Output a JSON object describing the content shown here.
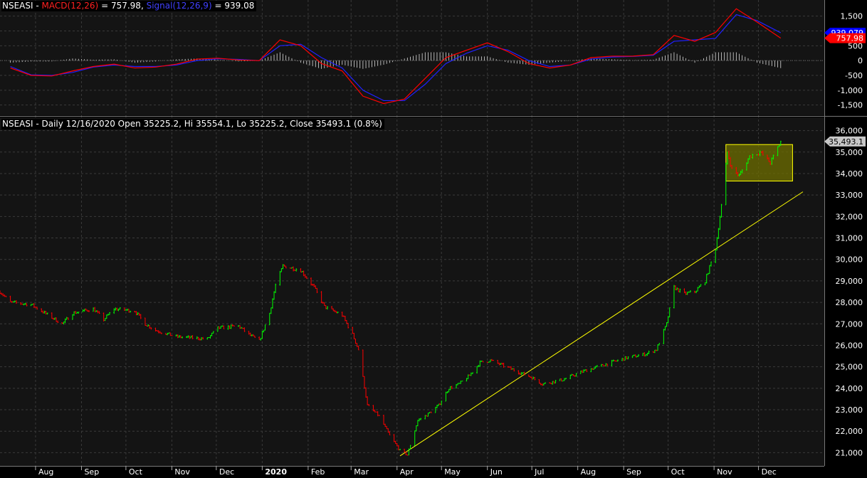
{
  "macd_panel": {
    "symbol": "NSEASI",
    "sep": "-",
    "macd_label": "MACD(12,26)",
    "macd_value": "757.98",
    "signal_label": "Signal(12,26,9)",
    "signal_value": "939.08",
    "colors": {
      "macd": "#ff0000",
      "signal": "#2020ff",
      "hist": "#ffffff"
    },
    "badges": [
      {
        "text": "939.079",
        "value": 939.08,
        "bg": "#0000ff",
        "fg": "#ffffff"
      },
      {
        "text": "757.98",
        "value": 757.98,
        "bg": "#ff0000",
        "fg": "#ffffff"
      }
    ]
  },
  "price_panel": {
    "title": "NSEASI - Daily 12/16/2020 Open 35225.2, Hi 35554.1, Lo 35225.2, Close 35493.1 (0.8%)",
    "last_badge": {
      "text": "35,493.1",
      "value": 35493.1,
      "bg": "#c8c8c8",
      "fg": "#000000"
    },
    "colors": {
      "up": "#00ff00",
      "down": "#ff0000",
      "trendline": "#ffff00",
      "box_fill": "#6e6e00",
      "box_stroke": "#ffff00"
    }
  },
  "chart_data": [
    {
      "type": "line",
      "title": "MACD(12,26) / Signal(12,26,9)",
      "y_ticks": [
        1500,
        1000,
        500,
        0,
        -500,
        -1000,
        -1500
      ],
      "y_tick_labels": [
        "1,500",
        "1,000",
        "500",
        "0",
        "-500",
        "-1,000",
        "-1,500"
      ],
      "ylim": [
        -1700,
        1900
      ],
      "x": [
        "2019-07-15",
        "2019-07-29",
        "2019-08-12",
        "2019-08-26",
        "2019-09-09",
        "2019-09-23",
        "2019-10-07",
        "2019-10-21",
        "2019-11-04",
        "2019-11-18",
        "2019-12-02",
        "2019-12-16",
        "2019-12-30",
        "2020-01-13",
        "2020-01-27",
        "2020-02-10",
        "2020-02-24",
        "2020-03-09",
        "2020-03-23",
        "2020-04-06",
        "2020-04-20",
        "2020-05-04",
        "2020-05-18",
        "2020-06-01",
        "2020-06-15",
        "2020-06-29",
        "2020-07-13",
        "2020-07-27",
        "2020-08-10",
        "2020-08-24",
        "2020-09-07",
        "2020-09-21",
        "2020-10-05",
        "2020-10-19",
        "2020-11-02",
        "2020-11-16",
        "2020-11-30",
        "2020-12-16"
      ],
      "series": [
        {
          "name": "MACD(12,26)",
          "values": [
            -250,
            -500,
            -520,
            -350,
            -200,
            -120,
            -250,
            -220,
            -120,
            50,
            80,
            20,
            0,
            700,
            500,
            -100,
            -350,
            -1200,
            -1450,
            -1300,
            -600,
            100,
            350,
            600,
            300,
            -100,
            -250,
            -150,
            100,
            150,
            150,
            200,
            850,
            650,
            950,
            1750,
            1300,
            757.98
          ]
        },
        {
          "name": "Signal(12,26,9)",
          "values": [
            -200,
            -480,
            -500,
            -400,
            -220,
            -150,
            -200,
            -200,
            -150,
            0,
            60,
            40,
            0,
            500,
            550,
            100,
            -250,
            -1000,
            -1350,
            -1350,
            -800,
            -100,
            250,
            500,
            350,
            0,
            -200,
            -150,
            50,
            120,
            140,
            180,
            650,
            700,
            750,
            1550,
            1350,
            939.08
          ]
        }
      ]
    },
    {
      "type": "candlestick",
      "title": "NSEASI - Daily",
      "y_ticks": [
        21000,
        22000,
        23000,
        24000,
        25000,
        26000,
        27000,
        28000,
        29000,
        30000,
        31000,
        32000,
        33000,
        34000,
        35000,
        36000
      ],
      "y_tick_labels": [
        "21,000",
        "22,000",
        "23,000",
        "24,000",
        "25,000",
        "26,000",
        "27,000",
        "28,000",
        "29,000",
        "30,000",
        "31,000",
        "32,000",
        "33,000",
        "34,000",
        "35,000",
        "36,000"
      ],
      "ylim": [
        20550,
        36450
      ],
      "x_tick_labels": [
        "Aug",
        "Sep",
        "Oct",
        "Nov",
        "Dec",
        "2020",
        "Feb",
        "Mar",
        "Apr",
        "May",
        "Jun",
        "Jul",
        "Aug",
        "Sep",
        "Oct",
        "Nov",
        "Dec"
      ],
      "x_tick_positions": [
        "2019-08-01",
        "2019-09-01",
        "2019-10-01",
        "2019-11-01",
        "2019-12-01",
        "2020-01-01",
        "2020-02-01",
        "2020-03-01",
        "2020-04-01",
        "2020-05-01",
        "2020-06-01",
        "2020-07-01",
        "2020-08-01",
        "2020-09-01",
        "2020-10-01",
        "2020-11-01",
        "2020-12-01"
      ],
      "x_start": "2019-07-08",
      "x_end": "2020-12-31",
      "close_path": [
        [
          "2019-07-08",
          28500
        ],
        [
          "2019-07-15",
          28000
        ],
        [
          "2019-07-29",
          27900
        ],
        [
          "2019-08-12",
          27300
        ],
        [
          "2019-08-19",
          27000
        ],
        [
          "2019-08-26",
          27500
        ],
        [
          "2019-09-09",
          27700
        ],
        [
          "2019-09-16",
          27200
        ],
        [
          "2019-09-23",
          27700
        ],
        [
          "2019-10-07",
          27600
        ],
        [
          "2019-10-14",
          27000
        ],
        [
          "2019-10-21",
          26700
        ],
        [
          "2019-11-04",
          26400
        ],
        [
          "2019-11-25",
          26300
        ],
        [
          "2019-12-02",
          26800
        ],
        [
          "2019-12-16",
          26900
        ],
        [
          "2019-12-23",
          26500
        ],
        [
          "2019-12-30",
          26200
        ],
        [
          "2020-01-06",
          27500
        ],
        [
          "2020-01-10",
          28800
        ],
        [
          "2020-01-15",
          29700
        ],
        [
          "2020-01-27",
          29500
        ],
        [
          "2020-02-05",
          28700
        ],
        [
          "2020-02-12",
          27800
        ],
        [
          "2020-02-24",
          27400
        ],
        [
          "2020-03-02",
          26500
        ],
        [
          "2020-03-06",
          25800
        ],
        [
          "2020-03-12",
          23200
        ],
        [
          "2020-03-20",
          22700
        ],
        [
          "2020-03-27",
          21800
        ],
        [
          "2020-04-03",
          21100
        ],
        [
          "2020-04-08",
          20900
        ],
        [
          "2020-04-15",
          22500
        ],
        [
          "2020-04-22",
          22800
        ],
        [
          "2020-04-29",
          23200
        ],
        [
          "2020-05-06",
          24000
        ],
        [
          "2020-05-13",
          24200
        ],
        [
          "2020-05-20",
          24600
        ],
        [
          "2020-05-27",
          25200
        ],
        [
          "2020-06-03",
          25300
        ],
        [
          "2020-06-17",
          24900
        ],
        [
          "2020-07-01",
          24500
        ],
        [
          "2020-07-08",
          24200
        ],
        [
          "2020-07-22",
          24400
        ],
        [
          "2020-08-05",
          24800
        ],
        [
          "2020-08-19",
          25100
        ],
        [
          "2020-09-02",
          25400
        ],
        [
          "2020-09-16",
          25600
        ],
        [
          "2020-09-23",
          25800
        ],
        [
          "2020-09-30",
          27000
        ],
        [
          "2020-10-05",
          28700
        ],
        [
          "2020-10-12",
          28400
        ],
        [
          "2020-10-19",
          28500
        ],
        [
          "2020-10-26",
          29000
        ],
        [
          "2020-11-02",
          30500
        ],
        [
          "2020-11-06",
          32500
        ],
        [
          "2020-11-10",
          35000
        ],
        [
          "2020-11-13",
          34200
        ],
        [
          "2020-11-18",
          33900
        ],
        [
          "2020-11-25",
          34800
        ],
        [
          "2020-12-02",
          35000
        ],
        [
          "2020-12-09",
          34500
        ],
        [
          "2020-12-16",
          35493.1
        ]
      ],
      "trendline": [
        [
          "2020-04-03",
          20850
        ],
        [
          "2020-12-31",
          33150
        ]
      ],
      "consolidation_box": {
        "x0": "2020-11-09",
        "x1": "2020-12-24",
        "y0": 33650,
        "y1": 35350
      }
    }
  ]
}
